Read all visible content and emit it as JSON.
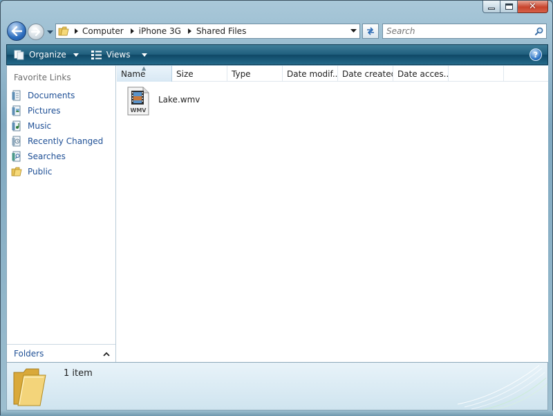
{
  "window": {
    "caption_buttons": {
      "minimize": "minimize",
      "maximize": "maximize",
      "close": "✕"
    }
  },
  "navigation": {
    "back_icon": "back-arrow-icon",
    "forward_icon": "forward-arrow-icon",
    "breadcrumbs": [
      "Computer",
      "iPhone 3G",
      "Shared Files"
    ],
    "search_placeholder": "Search"
  },
  "command_bar": {
    "organize_label": "Organize",
    "views_label": "Views",
    "help_label": "?"
  },
  "nav_pane": {
    "header": "Favorite Links",
    "items": [
      {
        "label": "Documents",
        "icon": "documents-icon"
      },
      {
        "label": "Pictures",
        "icon": "pictures-icon"
      },
      {
        "label": "Music",
        "icon": "music-icon"
      },
      {
        "label": "Recently Changed",
        "icon": "recently-changed-icon"
      },
      {
        "label": "Searches",
        "icon": "searches-icon"
      },
      {
        "label": "Public",
        "icon": "public-folder-icon"
      }
    ],
    "folders_label": "Folders"
  },
  "file_list": {
    "columns": [
      "Name",
      "Size",
      "Type",
      "Date modif...",
      "Date created",
      "Date acces..."
    ],
    "sorted_column": "Name",
    "files": [
      {
        "name": "Lake.wmv",
        "icon_label": "WMV"
      }
    ]
  },
  "details": {
    "item_count": "1 item"
  },
  "colors": {
    "link_blue": "#1e4f95",
    "command_bar": "#1f5e7d",
    "frame": "#9dbfd0"
  }
}
